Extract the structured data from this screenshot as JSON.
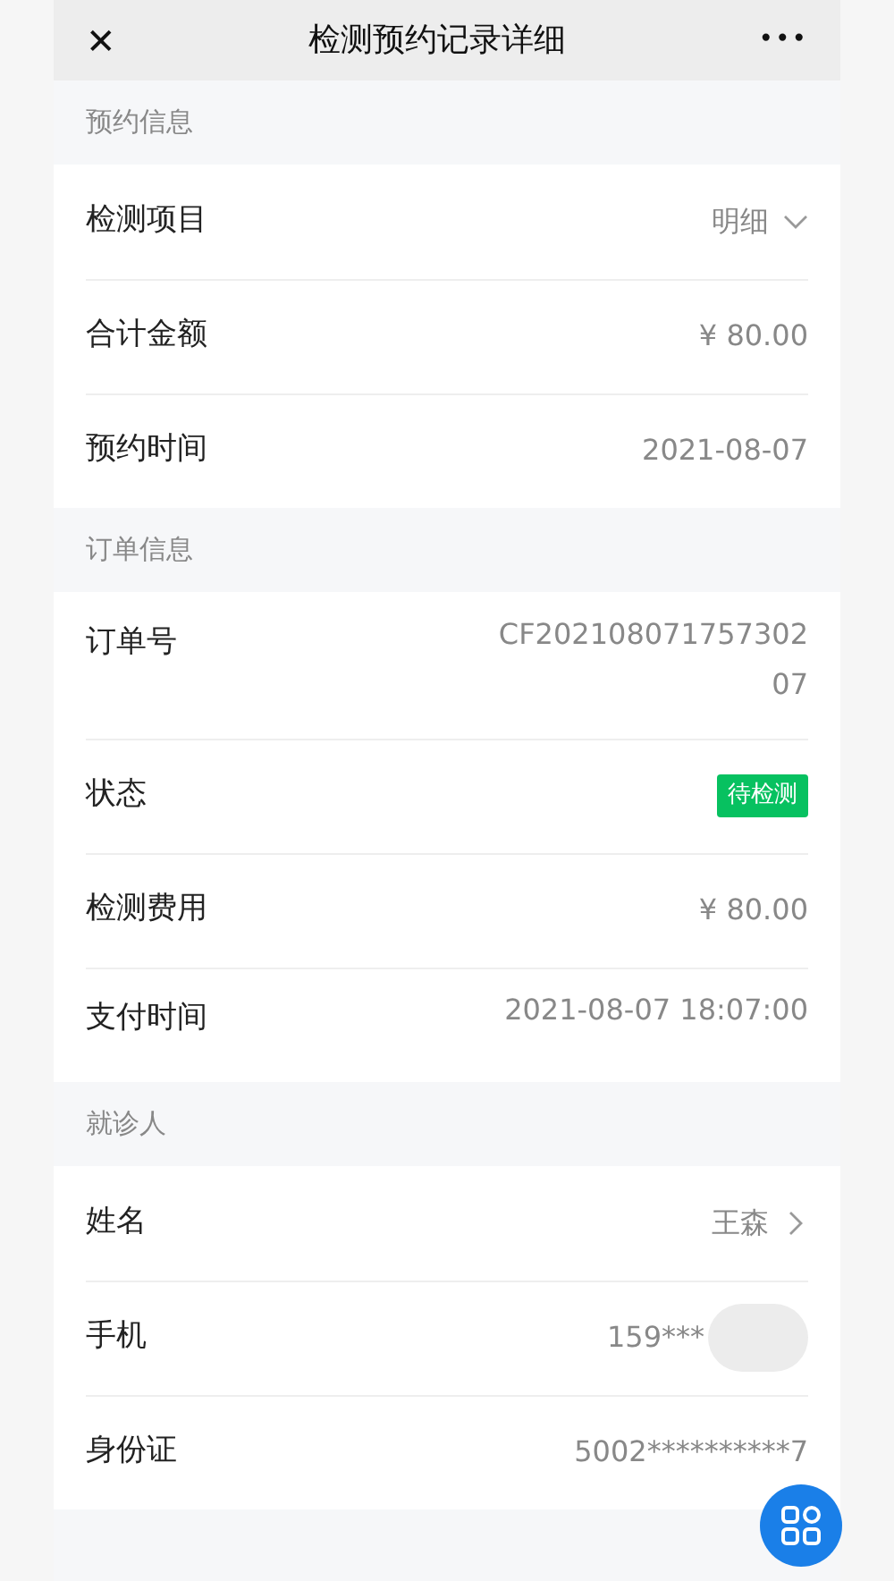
{
  "header": {
    "close": "✕",
    "title": "检测预约记录详细",
    "more": "•••"
  },
  "sections": [
    {
      "title": "预约信息",
      "rows": [
        {
          "kind": "dropdown",
          "label": "检测项目",
          "value": "明细"
        },
        {
          "kind": "text",
          "label": "合计金额",
          "value": "¥ 80.00"
        },
        {
          "kind": "text",
          "label": "预约时间",
          "value": "2021-08-07"
        }
      ]
    },
    {
      "title": "订单信息",
      "rows": [
        {
          "kind": "text",
          "label": "订单号",
          "value": "CF20210807175730207"
        },
        {
          "kind": "status",
          "label": "状态",
          "value": "待检测",
          "color": "#07c160"
        },
        {
          "kind": "text",
          "label": "检测费用",
          "value": "¥ 80.00"
        },
        {
          "kind": "text",
          "label": "支付时间",
          "value": "2021-08-07 18:07:00"
        }
      ]
    },
    {
      "title": "就诊人",
      "rows": [
        {
          "kind": "link",
          "label": "姓名",
          "value": "王森"
        },
        {
          "kind": "redacted",
          "label": "手机",
          "value": "159***"
        },
        {
          "kind": "text",
          "label": "身份证",
          "value": "5002**********7"
        }
      ]
    }
  ]
}
